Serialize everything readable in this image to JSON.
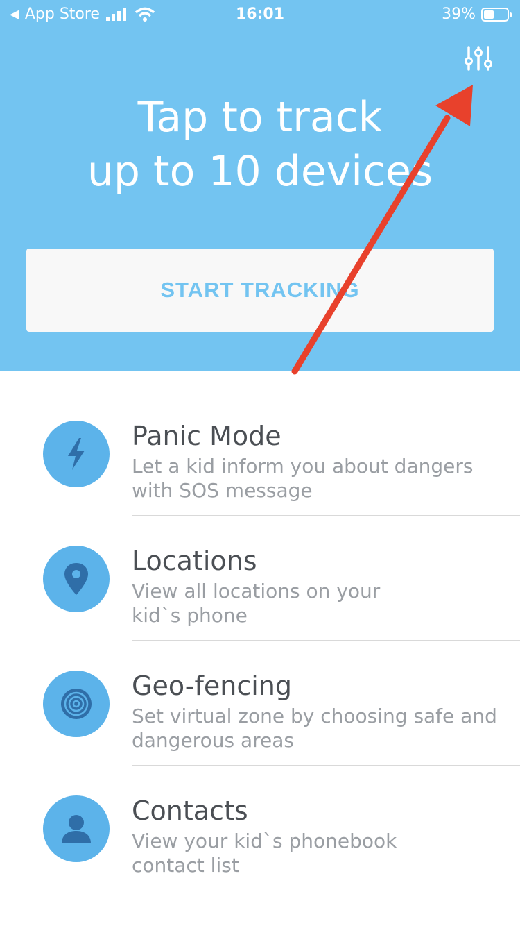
{
  "status_bar": {
    "back_label": "App Store",
    "time": "16:01",
    "battery": "39%",
    "battery_level": 0.39
  },
  "header": {
    "headline_line1": "Tap to track",
    "headline_line2": "up to 10 devices",
    "settings_icon": "sliders-icon",
    "start_button": "START TRACKING"
  },
  "colors": {
    "header_bg": "#73c4f1",
    "icon_circle": "#5cb3ea",
    "icon_glyph": "#2f6ea8",
    "annotation_arrow": "#e8412c"
  },
  "features": [
    {
      "title": "Panic Mode",
      "desc_line1": "Let a kid inform you about dangers",
      "desc_line2": "with SOS message",
      "icon": "lightning-icon"
    },
    {
      "title": "Locations",
      "desc_line1": "View all locations on your",
      "desc_line2": "kid`s phone",
      "icon": "location-pin-icon"
    },
    {
      "title": "Geo-fencing",
      "desc_line1": "Set virtual zone by choosing safe and",
      "desc_line2": "dangerous areas",
      "icon": "target-icon"
    },
    {
      "title": "Contacts",
      "desc_line1": "View your kid`s phonebook",
      "desc_line2": "contact list",
      "icon": "person-icon"
    }
  ]
}
